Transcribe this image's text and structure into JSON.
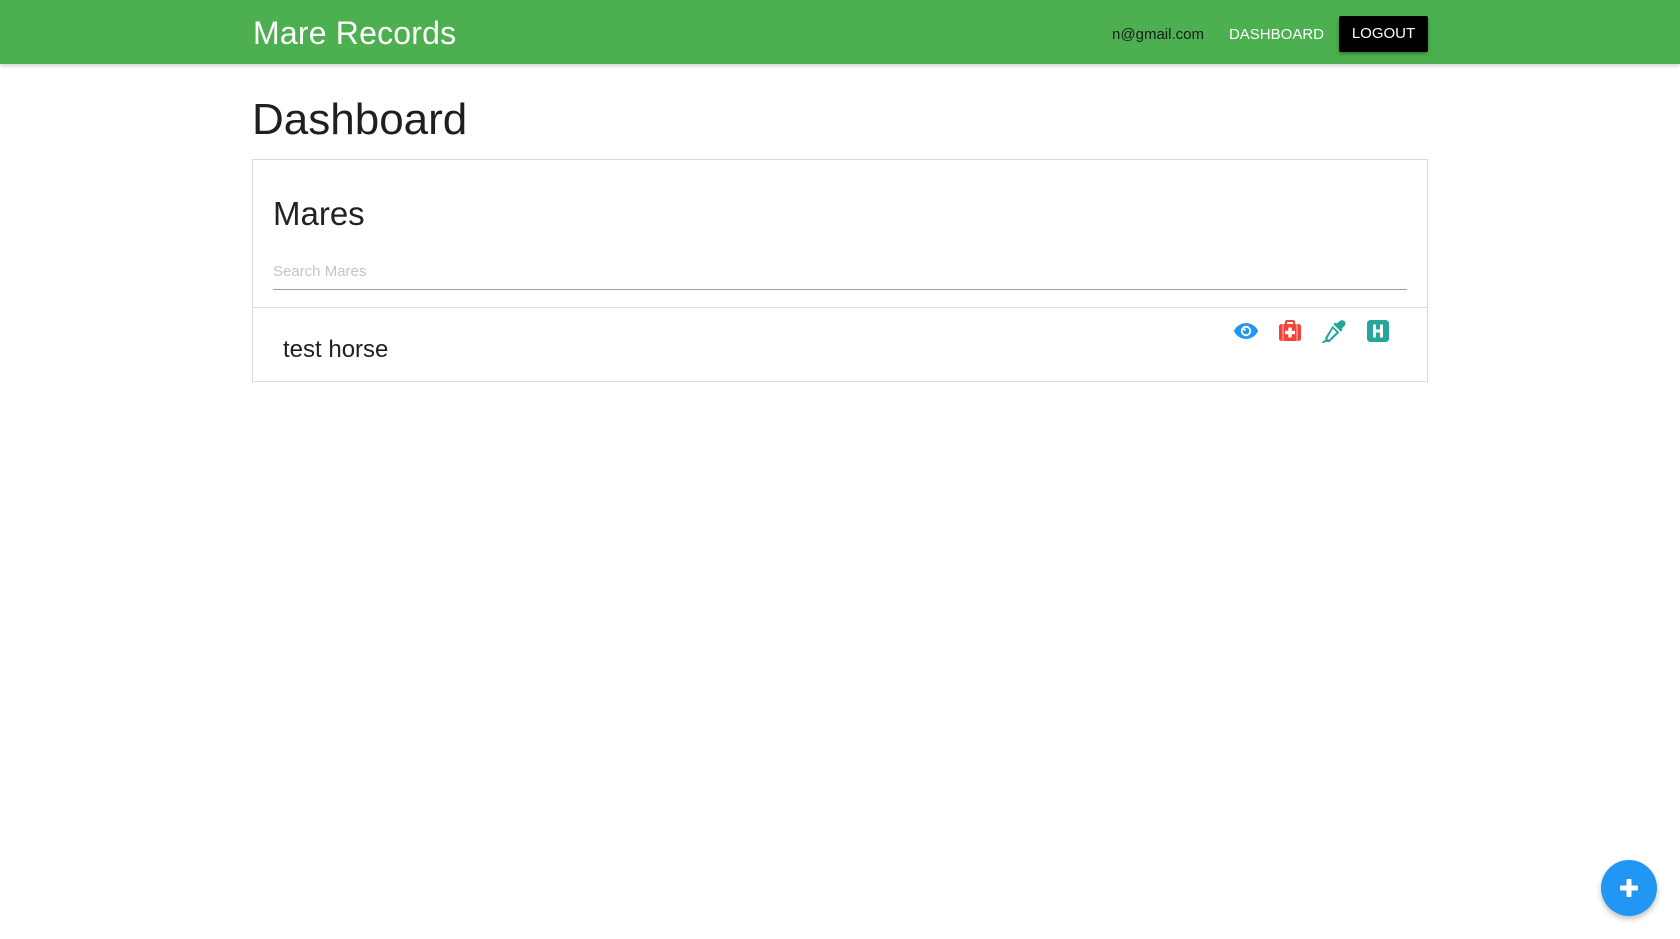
{
  "app": {
    "brand": "Mare Records"
  },
  "nav": {
    "email": "n@gmail.com",
    "dashboard_label": "DASHBOARD",
    "logout_label": "LOGOUT"
  },
  "page": {
    "title": "Dashboard"
  },
  "mares_card": {
    "title": "Mares",
    "search_placeholder": "Search Mares",
    "search_value": "",
    "items": [
      {
        "name": "test horse",
        "actions": [
          {
            "icon": "eye-icon",
            "color": "#2196f3"
          },
          {
            "icon": "medical-kit-icon",
            "color": "#f44336"
          },
          {
            "icon": "eyedropper-icon",
            "color": "#26a69a"
          },
          {
            "icon": "hospital-icon",
            "color": "#26a69a"
          }
        ]
      }
    ]
  },
  "fab": {
    "icon": "plus-icon",
    "color": "#2196f3"
  },
  "colors": {
    "navbar": "#4caf50",
    "logout_button": "#000000"
  }
}
